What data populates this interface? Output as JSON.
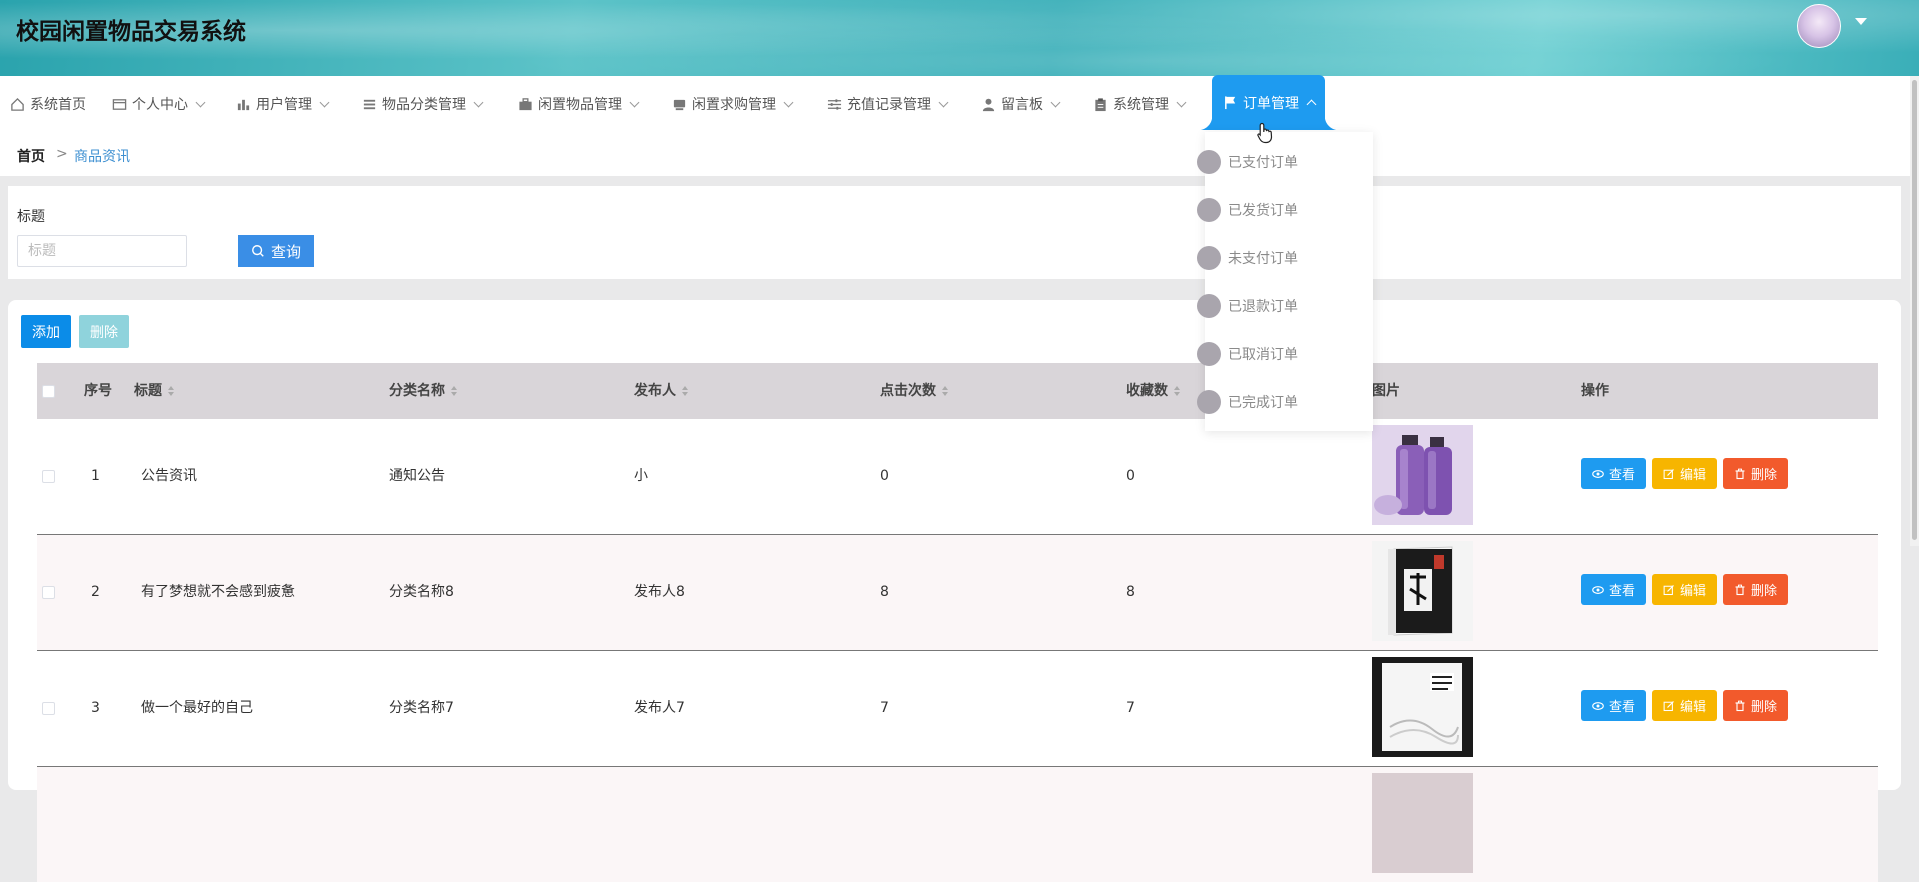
{
  "app": {
    "title": "校园闲置物品交易系统"
  },
  "nav": {
    "items": [
      {
        "label": "系统首页",
        "icon": "home-icon"
      },
      {
        "label": "个人中心",
        "icon": "profile-card-icon"
      },
      {
        "label": "用户管理",
        "icon": "bar-chart-icon"
      },
      {
        "label": "物品分类管理",
        "icon": "list-icon"
      },
      {
        "label": "闲置物品管理",
        "icon": "briefcase-icon"
      },
      {
        "label": "闲置求购管理",
        "icon": "cart-icon"
      },
      {
        "label": "充值记录管理",
        "icon": "sliders-icon"
      },
      {
        "label": "留言板",
        "icon": "user-icon"
      },
      {
        "label": "系统管理",
        "icon": "clipboard-icon"
      },
      {
        "label": "订单管理",
        "icon": "flag-icon",
        "active": true
      }
    ],
    "order_submenu": [
      "已支付订单",
      "已发货订单",
      "未支付订单",
      "已退款订单",
      "已取消订单",
      "已完成订单"
    ]
  },
  "breadcrumb": {
    "home": "首页",
    "separator": ">",
    "current": "商品资讯"
  },
  "search": {
    "label": "标题",
    "placeholder": "标题",
    "button": "查询"
  },
  "toolbar": {
    "add": "添加",
    "delete": "删除"
  },
  "table": {
    "columns": [
      "序号",
      "标题",
      "分类名称",
      "发布人",
      "点击次数",
      "收藏数",
      "图片",
      "操作"
    ],
    "actions": {
      "view": "查看",
      "edit": "编辑",
      "delete": "删除"
    },
    "rows": [
      {
        "index": "1",
        "title": "公告资讯",
        "category": "通知公告",
        "publisher": "小",
        "clicks": "0",
        "favorites": "0",
        "image": "purple-shampoo-bottles"
      },
      {
        "index": "2",
        "title": "有了梦想就不会感到疲惫",
        "category": "分类名称8",
        "publisher": "发布人8",
        "clicks": "8",
        "favorites": "8",
        "image": "book-cover-black"
      },
      {
        "index": "3",
        "title": "做一个最好的自己",
        "category": "分类名称7",
        "publisher": "发布人7",
        "clicks": "7",
        "favorites": "7",
        "image": "book-cover-white"
      }
    ]
  },
  "colors": {
    "accent": "#1e9bf0",
    "header_teal": "#3aaeb8",
    "edit": "#f7b500",
    "danger": "#f25a2c"
  }
}
